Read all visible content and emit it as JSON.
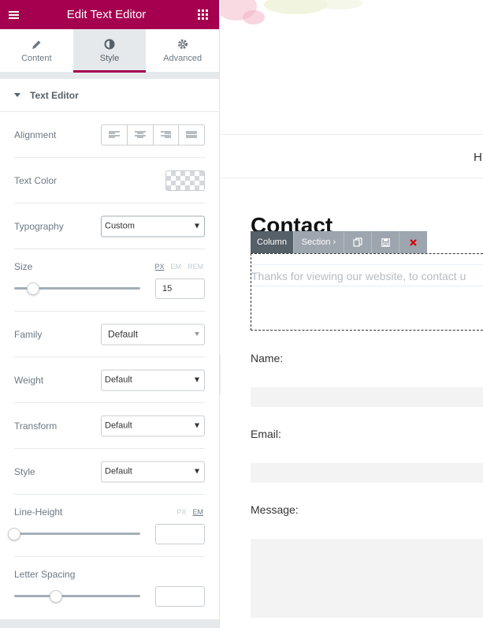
{
  "panel": {
    "title": "Edit Text Editor",
    "tabs": [
      {
        "label": "Content",
        "icon": "pencil-icon"
      },
      {
        "label": "Style",
        "icon": "contrast-icon"
      },
      {
        "label": "Advanced",
        "icon": "gear-icon"
      }
    ],
    "active_tab": "Style",
    "section_title": "Text Editor",
    "controls": {
      "alignment": {
        "label": "Alignment",
        "options": [
          "left",
          "center",
          "right",
          "justify"
        ]
      },
      "text_color": {
        "label": "Text Color"
      },
      "typography": {
        "label": "Typography",
        "value": "Custom"
      },
      "size": {
        "label": "Size",
        "units": [
          "PX",
          "EM",
          "REM"
        ],
        "active_unit": "PX",
        "value": "15",
        "slider_fraction": 0.15
      },
      "family": {
        "label": "Family",
        "value": "Default"
      },
      "weight": {
        "label": "Weight",
        "value": "Default"
      },
      "transform": {
        "label": "Transform",
        "value": "Default"
      },
      "style": {
        "label": "Style",
        "value": "Default"
      },
      "line_height": {
        "label": "Line-Height",
        "units": [
          "PX",
          "EM"
        ],
        "active_unit": "EM",
        "value": "",
        "slider_fraction": 0.0
      },
      "letter_spacing": {
        "label": "Letter Spacing",
        "value": "",
        "slider_fraction": 0.33
      }
    },
    "accent_color": "#a4004f"
  },
  "preview": {
    "nav_partial": "H",
    "heading": "Contact",
    "toolbar": {
      "column": "Column",
      "section": "Section ›",
      "icons": [
        "duplicate-icon",
        "save-icon",
        "delete-icon"
      ]
    },
    "text_editor_content": "Thanks for viewing our website, to contact u",
    "form": {
      "name_label": "Name:",
      "email_label": "Email:",
      "message_label": "Message:"
    }
  }
}
